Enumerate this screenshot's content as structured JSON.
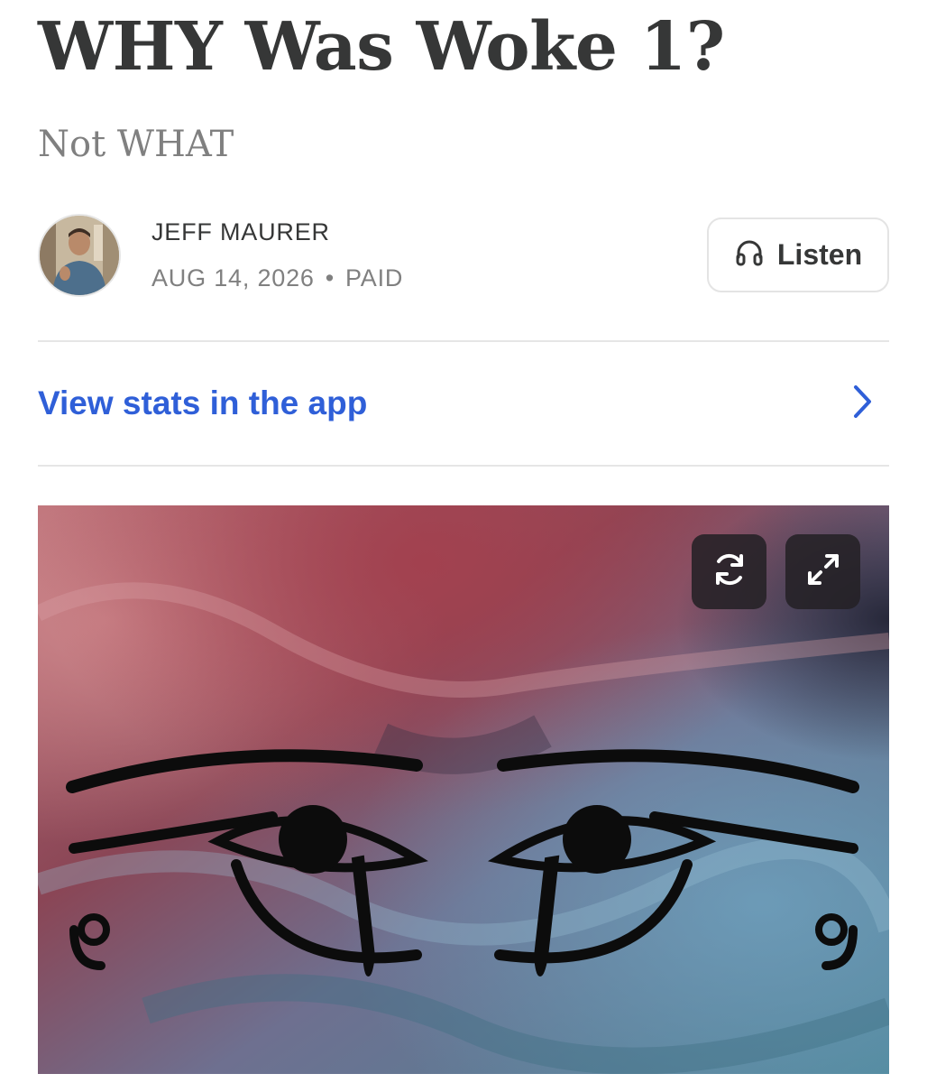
{
  "post": {
    "title": "WHY Was Woke 1?",
    "subtitle": "Not WHAT"
  },
  "byline": {
    "author": "JEFF MAURER",
    "date": "AUG 14, 2026",
    "separator": "•",
    "access": "PAID"
  },
  "listen_button": {
    "label": "Listen",
    "icon": "headphones-icon"
  },
  "stats_link": {
    "label": "View stats in the app",
    "icon": "chevron-right-icon",
    "color": "#2f5fd8"
  },
  "hero_image": {
    "subject": "eye-of-horus-pair",
    "actions": [
      {
        "name": "refresh",
        "icon": "refresh-icon"
      },
      {
        "name": "expand",
        "icon": "expand-icon"
      }
    ]
  },
  "colors": {
    "title": "#363737",
    "muted": "#808080",
    "link": "#2f5fd8",
    "divider": "#e6e6e6"
  }
}
